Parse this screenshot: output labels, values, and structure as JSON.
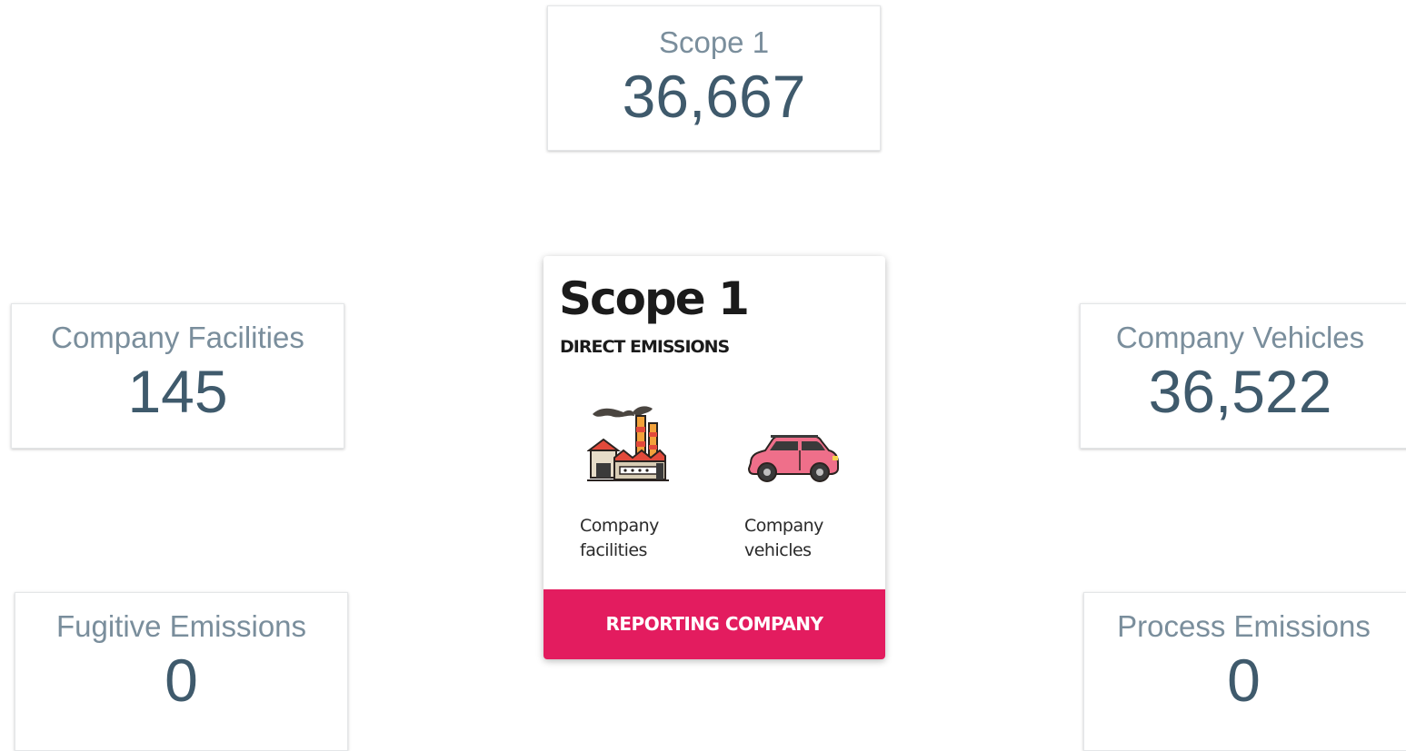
{
  "kpis": {
    "scope1": {
      "label": "Scope 1",
      "value": "36,667"
    },
    "company_facilities": {
      "label": "Company Facilities",
      "value": "145"
    },
    "company_vehicles": {
      "label": "Company Vehicles",
      "value": "36,522"
    },
    "fugitive_emissions": {
      "label": "Fugitive Emissions",
      "value": "0"
    },
    "process_emissions": {
      "label": "Process Emissions",
      "value": "0"
    }
  },
  "scope_card": {
    "title": "Scope 1",
    "subtitle": "DIRECT EMISSIONS",
    "items": [
      {
        "icon": "factory-icon",
        "caption_line1": "Company",
        "caption_line2": "facilities"
      },
      {
        "icon": "car-icon",
        "caption_line1": "Company",
        "caption_line2": "vehicles"
      }
    ],
    "footer": "REPORTING COMPANY"
  },
  "colors": {
    "label_text": "#7a8e9c",
    "value_text": "#3f5a6c",
    "footer_accent": "#e31c5f",
    "car_body": "#ef6f8a",
    "factory_roof": "#e24a3b"
  }
}
